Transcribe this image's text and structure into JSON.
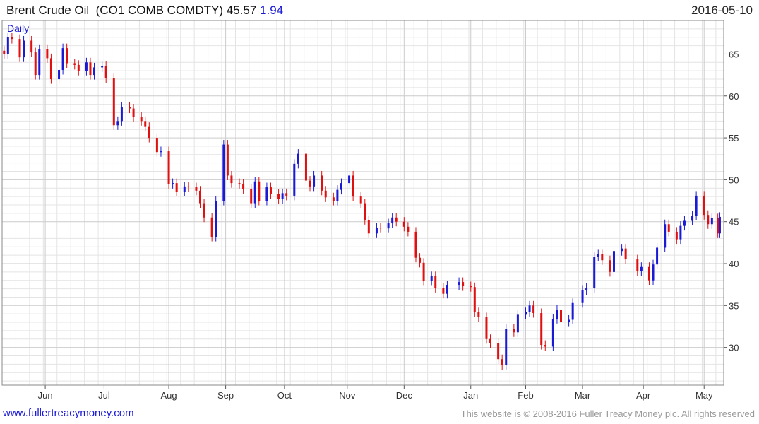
{
  "header": {
    "name": "Brent Crude Oil",
    "ticker": "(CO1 COMB COMDTY)",
    "last": "45.57",
    "change": "1.94",
    "date": "2016-05-10"
  },
  "footer": {
    "site": "www.fullertreacymoney.com",
    "copyright": "This website is © 2008-2016 Fuller Treacy Money plc. All rights reserved"
  },
  "colors": {
    "up": "#1a1ad6",
    "down": "#e01010",
    "grid": "#cccccc",
    "grid_minor": "#e4e4e4"
  },
  "chart_data": {
    "type": "candlestick",
    "period_label": "Daily",
    "ylim": [
      25.5,
      69
    ],
    "yticks": [
      30,
      35,
      40,
      45,
      50,
      55,
      60,
      65
    ],
    "xlim": [
      "2015-05-10",
      "2016-05-12"
    ],
    "month_ticks": [
      {
        "date": "2015-06-01",
        "label": "Jun"
      },
      {
        "date": "2015-07-01",
        "label": "Jul"
      },
      {
        "date": "2015-08-03",
        "label": "Aug"
      },
      {
        "date": "2015-09-01",
        "label": "Sep"
      },
      {
        "date": "2015-10-01",
        "label": "Oct"
      },
      {
        "date": "2015-11-02",
        "label": "Nov"
      },
      {
        "date": "2015-12-01",
        "label": "Dec"
      },
      {
        "date": "2016-01-04",
        "label": "Jan"
      },
      {
        "date": "2016-02-01",
        "label": "Feb"
      },
      {
        "date": "2016-03-01",
        "label": "Mar"
      },
      {
        "date": "2016-04-01",
        "label": "Apr"
      },
      {
        "date": "2016-05-02",
        "label": "May"
      }
    ],
    "closes": [
      [
        "2015-05-11",
        65.0
      ],
      [
        "2015-05-13",
        67.0
      ],
      [
        "2015-05-15",
        66.8
      ],
      [
        "2015-05-19",
        64.6
      ],
      [
        "2015-05-21",
        66.6
      ],
      [
        "2015-05-25",
        65.2
      ],
      [
        "2015-05-27",
        62.5
      ],
      [
        "2015-05-29",
        65.6
      ],
      [
        "2015-06-02",
        64.5
      ],
      [
        "2015-06-04",
        62.0
      ],
      [
        "2015-06-08",
        63.1
      ],
      [
        "2015-06-10",
        65.7
      ],
      [
        "2015-06-12",
        63.9
      ],
      [
        "2015-06-16",
        63.7
      ],
      [
        "2015-06-18",
        63.0
      ],
      [
        "2015-06-22",
        64.0
      ],
      [
        "2015-06-24",
        62.5
      ],
      [
        "2015-06-26",
        63.4
      ],
      [
        "2015-06-30",
        63.6
      ],
      [
        "2015-07-02",
        62.1
      ],
      [
        "2015-07-06",
        56.5
      ],
      [
        "2015-07-08",
        57.0
      ],
      [
        "2015-07-10",
        58.7
      ],
      [
        "2015-07-14",
        58.5
      ],
      [
        "2015-07-16",
        57.5
      ],
      [
        "2015-07-20",
        57.0
      ],
      [
        "2015-07-22",
        56.3
      ],
      [
        "2015-07-24",
        55.0
      ],
      [
        "2015-07-28",
        53.3
      ],
      [
        "2015-07-30",
        53.4
      ],
      [
        "2015-08-03",
        49.5
      ],
      [
        "2015-08-05",
        49.6
      ],
      [
        "2015-08-07",
        48.6
      ],
      [
        "2015-08-11",
        49.2
      ],
      [
        "2015-08-13",
        49.1
      ],
      [
        "2015-08-17",
        48.7
      ],
      [
        "2015-08-19",
        47.2
      ],
      [
        "2015-08-21",
        45.5
      ],
      [
        "2015-08-25",
        43.2
      ],
      [
        "2015-08-27",
        47.5
      ],
      [
        "2015-08-31",
        54.2
      ],
      [
        "2015-09-02",
        50.5
      ],
      [
        "2015-09-04",
        49.6
      ],
      [
        "2015-09-08",
        49.5
      ],
      [
        "2015-09-10",
        48.9
      ],
      [
        "2015-09-14",
        47.2
      ],
      [
        "2015-09-16",
        49.8
      ],
      [
        "2015-09-18",
        47.5
      ],
      [
        "2015-09-22",
        49.1
      ],
      [
        "2015-09-24",
        48.3
      ],
      [
        "2015-09-28",
        47.7
      ],
      [
        "2015-09-30",
        48.4
      ],
      [
        "2015-10-02",
        48.1
      ],
      [
        "2015-10-06",
        51.9
      ],
      [
        "2015-10-08",
        53.1
      ],
      [
        "2015-10-12",
        49.9
      ],
      [
        "2015-10-14",
        49.2
      ],
      [
        "2015-10-16",
        50.5
      ],
      [
        "2015-10-20",
        48.7
      ],
      [
        "2015-10-22",
        47.9
      ],
      [
        "2015-10-26",
        47.5
      ],
      [
        "2015-10-28",
        48.8
      ],
      [
        "2015-10-30",
        49.6
      ],
      [
        "2015-11-03",
        50.5
      ],
      [
        "2015-11-05",
        48.0
      ],
      [
        "2015-11-09",
        47.2
      ],
      [
        "2015-11-11",
        45.2
      ],
      [
        "2015-11-13",
        43.6
      ],
      [
        "2015-11-17",
        44.3
      ],
      [
        "2015-11-19",
        44.2
      ],
      [
        "2015-11-23",
        44.8
      ],
      [
        "2015-11-25",
        45.5
      ],
      [
        "2015-11-27",
        45.0
      ],
      [
        "2015-12-01",
        44.4
      ],
      [
        "2015-12-03",
        43.8
      ],
      [
        "2015-12-07",
        40.7
      ],
      [
        "2015-12-09",
        40.1
      ],
      [
        "2015-12-11",
        37.9
      ],
      [
        "2015-12-15",
        38.5
      ],
      [
        "2015-12-17",
        37.1
      ],
      [
        "2015-12-21",
        36.4
      ],
      [
        "2015-12-23",
        37.4
      ],
      [
        "2015-12-29",
        37.8
      ],
      [
        "2015-12-31",
        37.3
      ],
      [
        "2016-01-04",
        37.2
      ],
      [
        "2016-01-06",
        34.2
      ],
      [
        "2016-01-08",
        33.6
      ],
      [
        "2016-01-12",
        31.0
      ],
      [
        "2016-01-14",
        30.5
      ],
      [
        "2016-01-18",
        28.6
      ],
      [
        "2016-01-20",
        27.9
      ],
      [
        "2016-01-22",
        32.2
      ],
      [
        "2016-01-26",
        31.8
      ],
      [
        "2016-01-28",
        33.9
      ],
      [
        "2016-02-01",
        34.2
      ],
      [
        "2016-02-03",
        35.0
      ],
      [
        "2016-02-05",
        34.1
      ],
      [
        "2016-02-09",
        30.3
      ],
      [
        "2016-02-11",
        30.1
      ],
      [
        "2016-02-15",
        33.4
      ],
      [
        "2016-02-17",
        34.5
      ],
      [
        "2016-02-19",
        33.0
      ],
      [
        "2016-02-23",
        33.3
      ],
      [
        "2016-02-25",
        35.3
      ],
      [
        "2016-03-01",
        36.8
      ],
      [
        "2016-03-03",
        37.1
      ],
      [
        "2016-03-07",
        40.8
      ],
      [
        "2016-03-09",
        41.1
      ],
      [
        "2016-03-11",
        40.4
      ],
      [
        "2016-03-15",
        39.0
      ],
      [
        "2016-03-17",
        41.5
      ],
      [
        "2016-03-21",
        41.8
      ],
      [
        "2016-03-23",
        40.5
      ],
      [
        "2016-03-29",
        39.1
      ],
      [
        "2016-03-31",
        39.6
      ],
      [
        "2016-04-04",
        38.0
      ],
      [
        "2016-04-06",
        39.9
      ],
      [
        "2016-04-08",
        41.9
      ],
      [
        "2016-04-12",
        44.7
      ],
      [
        "2016-04-14",
        43.8
      ],
      [
        "2016-04-18",
        42.9
      ],
      [
        "2016-04-20",
        44.5
      ],
      [
        "2016-04-22",
        45.1
      ],
      [
        "2016-04-26",
        45.7
      ],
      [
        "2016-04-28",
        48.1
      ],
      [
        "2016-05-02",
        45.8
      ],
      [
        "2016-05-04",
        44.7
      ],
      [
        "2016-05-06",
        45.4
      ],
      [
        "2016-05-09",
        43.6
      ],
      [
        "2016-05-10",
        45.57
      ]
    ]
  }
}
